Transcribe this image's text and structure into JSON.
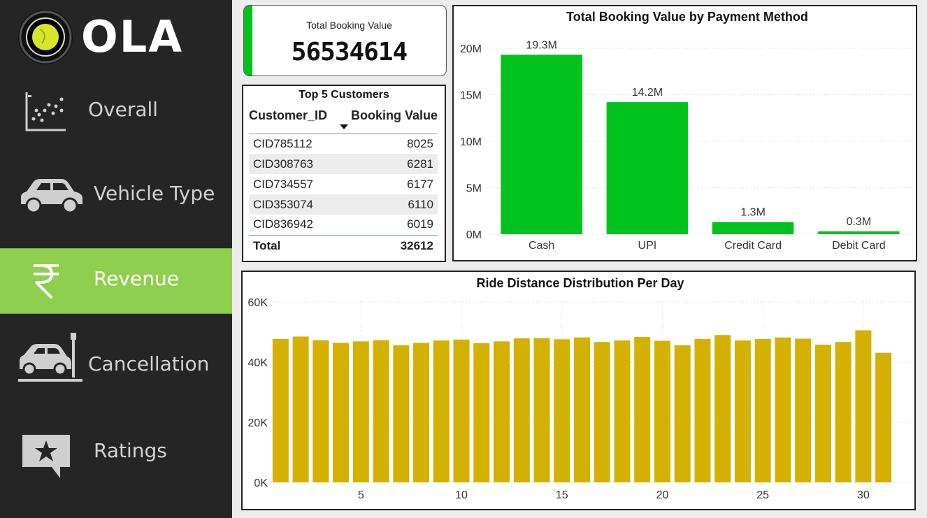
{
  "sidebar": {
    "logo_text": "OLA",
    "items": [
      {
        "label": "Overall",
        "icon": "scatter-plot-icon"
      },
      {
        "label": "Vehicle Type",
        "icon": "car-icon"
      },
      {
        "label": "Revenue",
        "icon": "rupee-icon",
        "active": true
      },
      {
        "label": "Cancellation",
        "icon": "car-crash-icon"
      },
      {
        "label": "Ratings",
        "icon": "star-comment-icon"
      }
    ],
    "active_color": "#8fcf4f",
    "bg_color": "#252526"
  },
  "kpi": {
    "title": "Total Booking Value",
    "value": "56534614",
    "accent_color": "#00c21c"
  },
  "top_customers": {
    "title": "Top 5 Customers",
    "columns": [
      "Customer_ID",
      "Booking Value"
    ],
    "rows": [
      [
        "CID785112",
        "8025"
      ],
      [
        "CID308763",
        "6281"
      ],
      [
        "CID734557",
        "6177"
      ],
      [
        "CID353074",
        "6110"
      ],
      [
        "CID836942",
        "6019"
      ]
    ],
    "total_label": "Total",
    "total_value": "32612"
  },
  "chart_data": [
    {
      "type": "bar",
      "title": "Total Booking Value by Payment Method",
      "categories": [
        "Cash",
        "UPI",
        "Credit Card",
        "Debit Card"
      ],
      "values": [
        19.3,
        14.2,
        1.3,
        0.3
      ],
      "unit": "M",
      "data_labels": [
        "19.3M",
        "14.2M",
        "1.3M",
        "0.3M"
      ],
      "yticks": [
        "0M",
        "5M",
        "10M",
        "15M",
        "20M"
      ],
      "ylim": [
        0,
        20
      ],
      "color": "#00c21c",
      "grid": true
    },
    {
      "type": "bar",
      "title": "Ride Distance Distribution Per Day",
      "x": [
        1,
        2,
        3,
        4,
        5,
        6,
        7,
        8,
        9,
        10,
        11,
        12,
        13,
        14,
        15,
        16,
        17,
        18,
        19,
        20,
        21,
        22,
        23,
        24,
        25,
        26,
        27,
        28,
        29,
        30,
        31
      ],
      "values": [
        47.7,
        48.5,
        47.3,
        46.4,
        46.9,
        47.3,
        45.6,
        46.4,
        47.2,
        47.5,
        46.3,
        46.9,
        47.9,
        48.0,
        47.6,
        48.2,
        46.7,
        47.2,
        48.4,
        47.1,
        45.6,
        47.7,
        49.0,
        47.2,
        47.7,
        48.2,
        47.8,
        45.8,
        46.7,
        50.6,
        43.1
      ],
      "xticks": [
        "5",
        "10",
        "15",
        "20",
        "25",
        "30"
      ],
      "yticks": [
        "0K",
        "20K",
        "40K",
        "60K"
      ],
      "ylim": [
        0,
        60
      ],
      "unit": "K",
      "color": "#d4b000",
      "grid": true
    }
  ]
}
